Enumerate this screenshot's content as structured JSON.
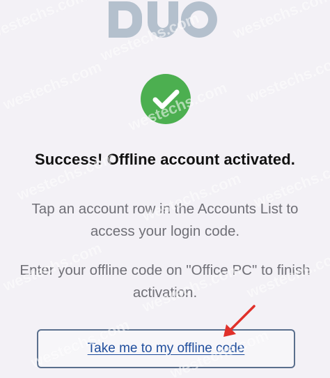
{
  "app": {
    "logo": {
      "icon": "duo-logo",
      "text": "DUO"
    }
  },
  "status": {
    "icon": "check-circle-icon",
    "title": "Success! Offline account activated."
  },
  "instructions": {
    "line_1": "Tap an account row in the Accounts List to access your login code.",
    "line_2": "Enter your offline code on \"Office PC\" to finish activation."
  },
  "actions": {
    "primary_label": "Take me to my offline code"
  },
  "annotation": {
    "icon": "red-arrow-icon"
  },
  "watermark": {
    "text": "westechs.com"
  },
  "colors": {
    "background": "#f3f1f6",
    "success_green": "#4caf50",
    "link_blue": "#1f4d9c",
    "button_border": "#5a6f8d",
    "annotation_red": "#e0302a"
  }
}
